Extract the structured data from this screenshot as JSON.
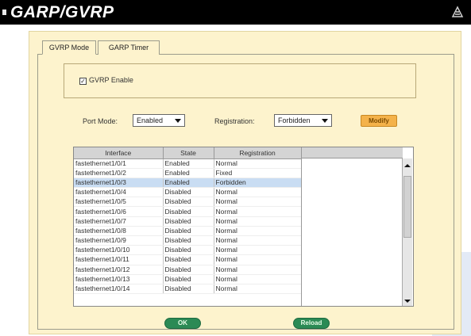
{
  "title": "GARP/GVRP",
  "tabs": [
    "GVRP Mode",
    "GARP Timer"
  ],
  "gvrp": {
    "label": "GVRP Enable",
    "checked": true
  },
  "port_mode": {
    "label": "Port Mode:",
    "value": "Enabled"
  },
  "registration": {
    "label": "Registration:",
    "value": "Forbidden"
  },
  "modify_label": "Modify",
  "table": {
    "headers": [
      "Interface",
      "State",
      "Registration"
    ],
    "rows": [
      [
        "fastethernet1/0/1",
        "Enabled",
        "Normal"
      ],
      [
        "fastethernet1/0/2",
        "Enabled",
        "Fixed"
      ],
      [
        "fastethernet1/0/3",
        "Enabled",
        "Forbidden"
      ],
      [
        "fastethernet1/0/4",
        "Disabled",
        "Normal"
      ],
      [
        "fastethernet1/0/5",
        "Disabled",
        "Normal"
      ],
      [
        "fastethernet1/0/6",
        "Disabled",
        "Normal"
      ],
      [
        "fastethernet1/0/7",
        "Disabled",
        "Normal"
      ],
      [
        "fastethernet1/0/8",
        "Disabled",
        "Normal"
      ],
      [
        "fastethernet1/0/9",
        "Disabled",
        "Normal"
      ],
      [
        "fastethernet1/0/10",
        "Disabled",
        "Normal"
      ],
      [
        "fastethernet1/0/11",
        "Disabled",
        "Normal"
      ],
      [
        "fastethernet1/0/12",
        "Disabled",
        "Normal"
      ],
      [
        "fastethernet1/0/13",
        "Disabled",
        "Normal"
      ],
      [
        "fastethernet1/0/14",
        "Disabled",
        "Normal"
      ]
    ],
    "selected_row": 2
  },
  "buttons": {
    "ok": "OK",
    "reload": "Reload"
  },
  "colors": {
    "title_bar": "#000000",
    "panel": "#fdf3cd",
    "modify": "#f4b24a",
    "action_button": "#2b8a55",
    "selected_row": "#c9ddf3"
  },
  "icons": [
    "window-logo-icon",
    "dropdown-arrow-icon",
    "scroll-up-icon",
    "scroll-down-icon",
    "checkmark-icon"
  ]
}
